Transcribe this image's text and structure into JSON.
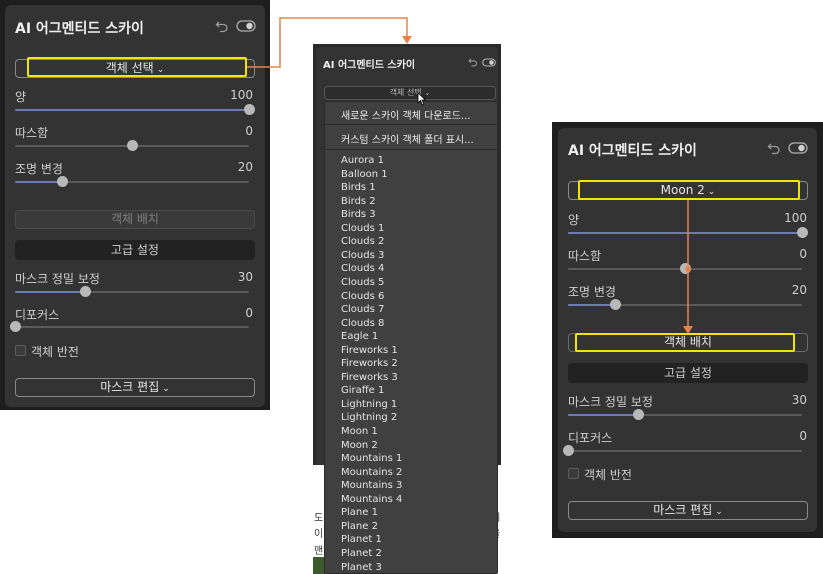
{
  "panel": {
    "title": "AI 어그멘티드 스카이",
    "rows": [
      {
        "label": "양"
      },
      {
        "label": "따스함"
      },
      {
        "label": "조명 변경"
      },
      {
        "label": "마스크 정밀 보정"
      },
      {
        "label": "디포커스"
      }
    ],
    "place_object_label": "객체 배치",
    "advanced_label": "고급 설정",
    "invert_label": "객체 반전",
    "edit_mask_label": "마스크 편집",
    "chevron": "⌄"
  },
  "left": {
    "select_label": "객체 선택",
    "values": {
      "amount": "100",
      "warmth": "0",
      "relight": "20",
      "mask_refine": "30",
      "defocus": "0"
    },
    "levels": {
      "amount": 1.0,
      "warmth": 0.5,
      "relight": 0.2,
      "mask_refine": 0.3,
      "defocus": 0.0
    }
  },
  "middle": {
    "select_label": "객체 선택",
    "menu_top": [
      "새로운 스카이 객체 다운로드...",
      "커스텀 스카이 객체 폴더 표시..."
    ],
    "items": [
      "Aurora 1",
      "Balloon 1",
      "Birds 1",
      "Birds 2",
      "Birds 3",
      "Clouds 1",
      "Clouds 2",
      "Clouds 3",
      "Clouds 4",
      "Clouds 5",
      "Clouds 6",
      "Clouds 7",
      "Clouds 8",
      "Eagle 1",
      "Fireworks 1",
      "Fireworks 2",
      "Fireworks 3",
      "Giraffe 1",
      "Lightning 1",
      "Lightning 2",
      "Moon 1",
      "Moon 2",
      "Mountains 1",
      "Mountains 2",
      "Mountains 3",
      "Mountains 4",
      "Plane 1",
      "Plane 2",
      "Planet 1",
      "Planet 2",
      "Planet 3"
    ],
    "bg_text": [
      "도",
      "이디",
      "맨",
      "제",
      "을"
    ]
  },
  "right": {
    "select_label": "Moon 2",
    "values": {
      "amount": "100",
      "warmth": "0",
      "relight": "20",
      "mask_refine": "30",
      "defocus": "0"
    },
    "levels": {
      "amount": 1.0,
      "warmth": 0.5,
      "relight": 0.2,
      "mask_refine": 0.3,
      "defocus": 0.0
    }
  },
  "colors": {
    "arrow": "#e8834a",
    "highlight": "#f2e600",
    "slider_fill": "#6d7bb4"
  },
  "icons": [
    "undo-icon",
    "toggle-icon",
    "chevron-down-icon",
    "mouse-cursor-icon"
  ]
}
